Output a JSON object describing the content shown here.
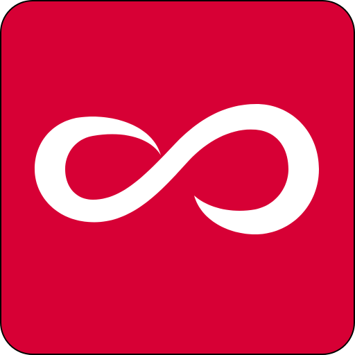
{
  "icon": {
    "symbol": "infinity-icon",
    "background_color": "#D70035",
    "border_color": "#000000",
    "symbol_color": "#FFFFFF"
  }
}
